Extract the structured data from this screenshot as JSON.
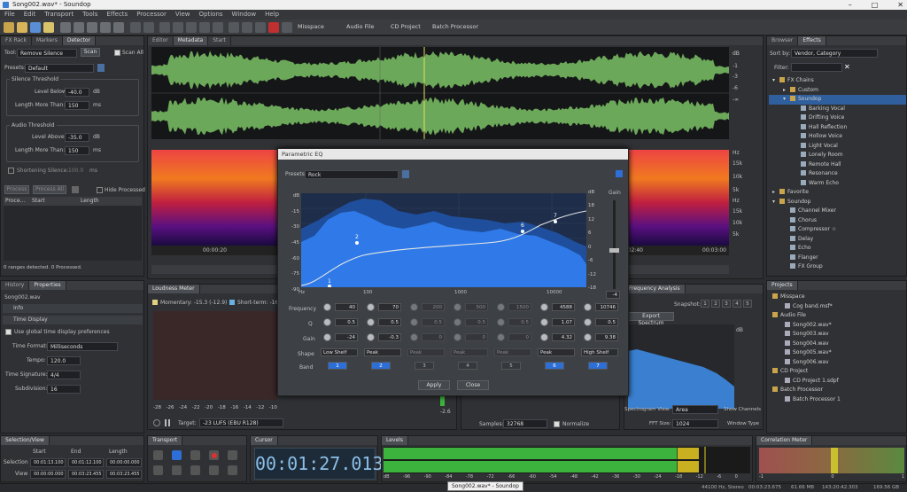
{
  "window": {
    "title": "Song002.wav* - Soundop",
    "controls": [
      "–",
      "□",
      "✕"
    ]
  },
  "menu": [
    "File",
    "Edit",
    "Transport",
    "Tools",
    "Effects",
    "Processor",
    "View",
    "Options",
    "Window",
    "Help"
  ],
  "toolbar": {
    "misspace": "Misspace",
    "audio_file": "Audio File",
    "cd_project": "CD Project",
    "batch_processor": "Batch Processor"
  },
  "left_panel": {
    "tabs": [
      "FX Rack",
      "Markers",
      "Detector"
    ],
    "tool_label": "Tool:",
    "tool_value": "Remove Silence",
    "scan": "Scan",
    "scan_all": "Scan All",
    "presets_label": "Presets:",
    "presets_value": "Default",
    "silence_threshold": "Silence Threshold",
    "level_below": "Level Below:",
    "level_below_value": "-40.0",
    "db": "dB",
    "length_more_than": "Length More Than:",
    "silence_length": "150",
    "ms": "ms",
    "audio_threshold": "Audio Threshold",
    "level_above": "Level Above:",
    "level_above_value": "-35.0",
    "audio_length": "150",
    "shortening": "Shortening Silence:",
    "shortening_value": "100.0",
    "shortening_unit": "ms",
    "process": "Process",
    "process_all": "Process All",
    "hide_processed": "Hide Processed",
    "columns": [
      "Proce...",
      "Start",
      "Length"
    ],
    "status": "0 ranges detected. 0 Processed."
  },
  "props": {
    "tabs": [
      "History",
      "Properties"
    ],
    "file": "Song002.wav",
    "info": "Info",
    "time_display": "Time Display",
    "use_global": "Use global time display preferences",
    "time_format_label": "Time Format:",
    "time_format": "Milliseconds",
    "tempo_label": "Tempo:",
    "tempo": "120.0",
    "time_sig_label": "Time Signature:",
    "time_sig": "4/4",
    "subdivision_label": "Subdivision:",
    "subdivision": "16"
  },
  "editor": {
    "tabs": [
      "Editor",
      "Metadata",
      "Start"
    ],
    "db_scale": [
      "dB",
      "-1",
      "-3",
      "-6",
      "-∞"
    ],
    "hz_scale": [
      "Hz",
      "15k",
      "10k",
      "5k"
    ],
    "times": [
      "00:00:20",
      "00:02:40",
      "00:03:00"
    ]
  },
  "eq": {
    "title": "Parametric EQ",
    "presets_label": "Presets:",
    "preset": "Rock",
    "gain_label": "Gain",
    "db_left": [
      "dB",
      "-15",
      "-30",
      "-45",
      "-60",
      "-75",
      "-90"
    ],
    "db_right": [
      "dB",
      "18",
      "12",
      "6",
      "0",
      "-6",
      "-12",
      "-18"
    ],
    "x_ticks": [
      "Hz",
      "100",
      "1000",
      "10000"
    ],
    "gain_value": "-4",
    "band_points": [
      "1",
      "2",
      "6",
      "7"
    ],
    "rows": {
      "frequency": "Frequency",
      "q": "Q",
      "gain": "Gain",
      "shape": "Shape",
      "band": "Band"
    },
    "bands": [
      {
        "freq": "40",
        "q": "0.5",
        "gain": "-24",
        "shape": "Low Shelf",
        "band": "1",
        "on": true
      },
      {
        "freq": "70",
        "q": "0.5",
        "gain": "-0.3",
        "shape": "Peak",
        "band": "2",
        "on": true
      },
      {
        "freq": "200",
        "q": "0.5",
        "gain": "0",
        "shape": "Peak",
        "band": "3",
        "on": false
      },
      {
        "freq": "500",
        "q": "0.5",
        "gain": "0",
        "shape": "Peak",
        "band": "4",
        "on": false
      },
      {
        "freq": "1500",
        "q": "0.5",
        "gain": "0",
        "shape": "Peak",
        "band": "5",
        "on": false
      },
      {
        "freq": "4588",
        "q": "1.07",
        "gain": "4.32",
        "shape": "Peak",
        "band": "6",
        "on": true
      },
      {
        "freq": "10746",
        "q": "0.5",
        "gain": "9.38",
        "shape": "High Shelf",
        "band": "7",
        "on": true
      }
    ],
    "apply": "Apply",
    "close": "Close"
  },
  "loudness": {
    "tab": "Loudness Meter",
    "momentary": "Momentary: -15.3 (-12.9)",
    "short_term": "Short-term: -16.7",
    "scale": [
      "-28",
      "-26",
      "-24",
      "-22",
      "-20",
      "-18",
      "-16",
      "-14",
      "-12",
      "-10"
    ],
    "target_label": "Target:",
    "target": "-23 LUFS (EBU R128)",
    "value": "-2.6"
  },
  "freq_analysis": {
    "tab": "Frequency Analysis",
    "snapshot": "Snapshot:",
    "snaps": [
      "1",
      "2",
      "3",
      "4",
      "5"
    ],
    "export": "Export Spectrum",
    "db": "dB",
    "view_label": "Spectrogram View:",
    "view": "Area",
    "fft_label": "FFT Size:",
    "fft": "1024",
    "show_channels": "Show Channels",
    "window_type": "Window Type"
  },
  "mid": {
    "samples_label": "Samples:",
    "samples": "32768",
    "normalize": "Normalize"
  },
  "browser": {
    "tabs": [
      "Browser",
      "Effects"
    ],
    "sort_label": "Sort by:",
    "sort": "Vendor, Category",
    "filter_label": "Filter:",
    "tree": [
      {
        "t": "FX Chains",
        "lvl": 0,
        "arrow": "▾"
      },
      {
        "t": "Custom",
        "lvl": 1,
        "arrow": "▸"
      },
      {
        "t": "Soundop",
        "lvl": 1,
        "arrow": "▾",
        "sel": true
      },
      {
        "t": "Barking Vocal",
        "lvl": 2
      },
      {
        "t": "Drifting Voice",
        "lvl": 2
      },
      {
        "t": "Hall Reflection",
        "lvl": 2
      },
      {
        "t": "Hollow Voice",
        "lvl": 2
      },
      {
        "t": "Light Vocal",
        "lvl": 2
      },
      {
        "t": "Lonely Room",
        "lvl": 2
      },
      {
        "t": "Remote Hall",
        "lvl": 2
      },
      {
        "t": "Resonance",
        "lvl": 2
      },
      {
        "t": "Warm Echo",
        "lvl": 2
      },
      {
        "t": "Favorite",
        "lvl": 0,
        "arrow": "▸"
      },
      {
        "t": "Soundop",
        "lvl": 0,
        "arrow": "▾"
      },
      {
        "t": "Channel Mixer",
        "lvl": 1
      },
      {
        "t": "Chorus",
        "lvl": 1
      },
      {
        "t": "Compressor",
        "lvl": 1,
        "star": "☆"
      },
      {
        "t": "Delay",
        "lvl": 1
      },
      {
        "t": "Echo",
        "lvl": 1
      },
      {
        "t": "Flanger",
        "lvl": 1
      },
      {
        "t": "FX Group",
        "lvl": 1
      }
    ]
  },
  "projects": {
    "tab": "Projects",
    "tree": [
      {
        "t": "Misspace",
        "lvl": 0
      },
      {
        "t": "Cog band.msf*",
        "lvl": 1
      },
      {
        "t": "Audio File",
        "lvl": 0
      },
      {
        "t": "Song002.wav*",
        "lvl": 1
      },
      {
        "t": "Song003.wav",
        "lvl": 1
      },
      {
        "t": "Song004.wav",
        "lvl": 1
      },
      {
        "t": "Song005.wav*",
        "lvl": 1
      },
      {
        "t": "Song006.wav",
        "lvl": 1
      },
      {
        "t": "CD Project",
        "lvl": 0
      },
      {
        "t": "CD Project 1.sdpf",
        "lvl": 1
      },
      {
        "t": "Batch Processor",
        "lvl": 0
      },
      {
        "t": "Batch Processor 1",
        "lvl": 1
      }
    ]
  },
  "selection": {
    "tab": "Selection/View",
    "cols": [
      "Start",
      "End",
      "Length"
    ],
    "sel_label": "Selection",
    "view_label": "View",
    "sel": [
      "00:01:13.100",
      "00:01:12.100",
      "00:00:00.000"
    ],
    "view": [
      "00:00:00.000",
      "00:03:23.455",
      "00:03:23.455"
    ]
  },
  "transport": {
    "tab": "Transport"
  },
  "cursor": {
    "tab": "Cursor",
    "time": "00:01:27.013"
  },
  "levels": {
    "tab": "Levels",
    "scale": [
      "dB",
      "-96",
      "-90",
      "-84",
      "-78",
      "-72",
      "-66",
      "-60",
      "-54",
      "-48",
      "-42",
      "-36",
      "-30",
      "-24",
      "-18",
      "-12",
      "-6",
      "0"
    ],
    "level_fraction": 0.87
  },
  "correlation": {
    "tab": "Correlation Meter",
    "scale": [
      "-1",
      "0",
      "1"
    ]
  },
  "status": {
    "tooltip": "Song002.wav* - Soundop",
    "format": "44100 Hz, Stereo",
    "length": "00:03:23.675",
    "size": "61.66 MB",
    "free": "143:20:42.303",
    "disk": "169.56 GB"
  }
}
